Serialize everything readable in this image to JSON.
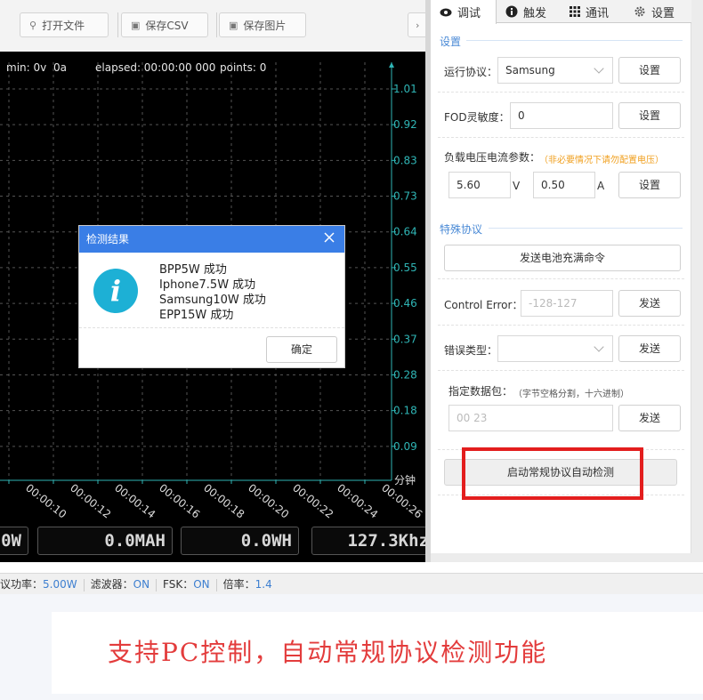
{
  "toolbar": {
    "buttons": [
      {
        "label": "打开文件",
        "icon": "search-icon"
      },
      {
        "label": "保存CSV",
        "icon": "save-icon"
      },
      {
        "label": "保存图片",
        "icon": "save-icon"
      }
    ]
  },
  "scope": {
    "min_label": "min: 0v",
    "current_label": "0a",
    "elapsed_label": "elapsed: 00:00:00 000",
    "points_label": "points: 0",
    "y_ticks": [
      "1.01",
      "0.92",
      "0.83",
      "0.73",
      "0.64",
      "0.55",
      "0.46",
      "0.37",
      "0.28",
      "0.18",
      "0.09"
    ],
    "x_unit": "分钟",
    "x_ticks": [
      "00:00:10",
      "00:00:12",
      "00:00:14",
      "00:00:16",
      "00:00:18",
      "00:00:20",
      "00:00:22",
      "00:00:24",
      "00:00:26"
    ],
    "colors": {
      "axis": "#2fb5b5",
      "grid": "#555555",
      "background": "#000000"
    }
  },
  "meters": [
    {
      "value": "0W"
    },
    {
      "value": "0.0MAH"
    },
    {
      "value": "0.0WH"
    },
    {
      "value": "127.3Khz"
    }
  ],
  "tabs": [
    {
      "label": "调试",
      "icon": "eye-icon",
      "active": true
    },
    {
      "label": "触发",
      "icon": "info-icon",
      "active": false
    },
    {
      "label": "通讯",
      "icon": "grid-icon",
      "active": false
    },
    {
      "label": "设置",
      "icon": "gear-icon",
      "active": false
    }
  ],
  "settings": {
    "section_title": "设置",
    "protocol_label": "运行协议：",
    "protocol_value": "Samsung",
    "protocol_button": "设置",
    "fod_label": "FOD灵敏度：",
    "fod_value": "0",
    "fod_button": "设置",
    "load_label": "负载电压电流参数：",
    "load_hint": "（非必要情况下请勿配置电压）",
    "voltage_value": "5.60",
    "voltage_unit": "V",
    "current_value": "0.50",
    "current_unit": "A",
    "load_button": "设置"
  },
  "special": {
    "section_title": "特殊协议",
    "battery_full_button": "发送电池充满命令",
    "control_error_label": "Control Error：",
    "control_error_placeholder": "-128-127",
    "control_error_button": "发送",
    "error_type_label": "错误类型：",
    "error_type_value": "",
    "error_type_button": "发送",
    "packet_label": "指定数据包：",
    "packet_hint": "（字节空格分割，十六进制）",
    "packet_placeholder": "00 23",
    "packet_button": "发送",
    "auto_detect_button": "启动常规协议自动检测"
  },
  "dialog": {
    "title": "检测结果",
    "icon": "info-icon",
    "lines": [
      "BPP5W 成功",
      "Iphone7.5W 成功",
      "Samsung10W 成功",
      "EPP15W 成功"
    ],
    "ok_label": "确定"
  },
  "status_bar": {
    "power_label": "协议功率：",
    "power_value": "5.00W",
    "filter_label": "滤波器：",
    "filter_value": "ON",
    "fsk_label": "FSK：",
    "fsk_value": "ON",
    "ratio_label": "倍率：",
    "ratio_value": "1.4"
  },
  "caption": "支持PC控制，自动常规协议检测功能",
  "colors": {
    "accent": "#3a7ee6",
    "highlight_red": "#e31e1e",
    "link_blue": "#3d7fd0",
    "warning_orange": "#f0a020"
  }
}
